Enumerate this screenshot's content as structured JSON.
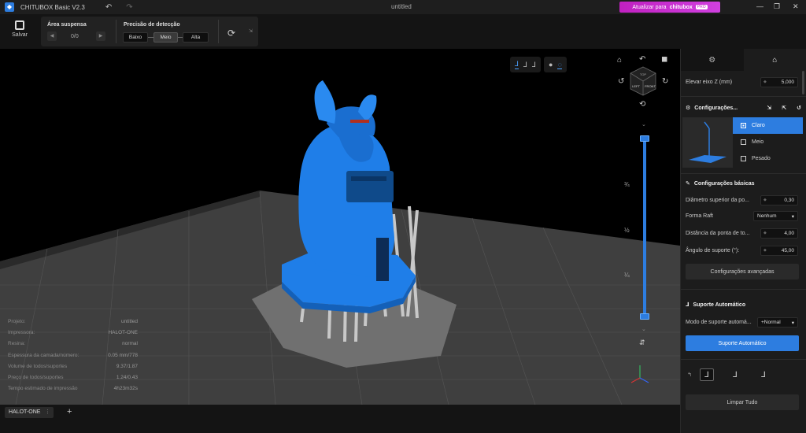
{
  "app": {
    "title": "CHITUBOX Basic V2.3",
    "document_title": "untitled",
    "upgrade_label": "Atualizar para",
    "upgrade_brand": "chitubox",
    "upgrade_badge": "PRO",
    "minimize": "—",
    "maximize": "❐",
    "close": "✕"
  },
  "toolbar": {
    "save_label": "Salvar",
    "suspended_area_label": "Área suspensa",
    "page_count": "0/0",
    "precision_label": "Precisão de detecção",
    "precision_options": [
      "Baixo",
      "Meio",
      "Alta"
    ],
    "precision_selected": "Meio"
  },
  "viewport": {
    "slider_fractions": [
      "¾",
      "½",
      "¼"
    ],
    "cube_faces": [
      "TOP",
      "LEFT",
      "FRONT"
    ],
    "info": [
      {
        "label": "Projeto:",
        "value": "untitled"
      },
      {
        "label": "Impressora:",
        "value": "HALOT-ONE"
      },
      {
        "label": "Resina:",
        "value": "normal"
      },
      {
        "label": "Espessura da camada/número:",
        "value": "0.05 mm/778"
      },
      {
        "label": "Volume de todos/suportes",
        "value": "9.37/1.87"
      },
      {
        "label": "Preço de todos/suportes",
        "value": "1.24/0.43"
      },
      {
        "label": "Tempo estimado de impressão",
        "value": "4h23m32s"
      }
    ]
  },
  "bottom": {
    "printer_tab": "HALOT-ONE"
  },
  "panel": {
    "raise_z_label": "Elevar eixo Z (mm)",
    "raise_z_value": "5,000",
    "presets_title": "Configurações...",
    "presets": [
      "Claro",
      "Meio",
      "Pesado"
    ],
    "preset_selected": "Claro",
    "basic_title": "Configurações básicas",
    "fields": [
      {
        "label": "Diâmetro superior da po...",
        "value": "0,30"
      },
      {
        "label": "Forma Raft",
        "value": "Nenhum"
      },
      {
        "label": "Distância da ponta de to...",
        "value": "4,00"
      },
      {
        "label": "Ângulo de suporte (°):",
        "value": "45,00"
      }
    ],
    "advanced_button": "Configurações avançadas",
    "auto_title": "Suporte Automático",
    "auto_mode_label": "Modo de suporte automá...",
    "auto_mode_value": "+Normal",
    "auto_button": "Suporte Automático",
    "clear_button": "Limpar Tudo"
  },
  "colors": {
    "accent": "#2d7de0",
    "model": "#1f7ee8",
    "support": "#c8c8c8",
    "floor": "#4a4a4a",
    "upgrade": "#c020c0"
  }
}
